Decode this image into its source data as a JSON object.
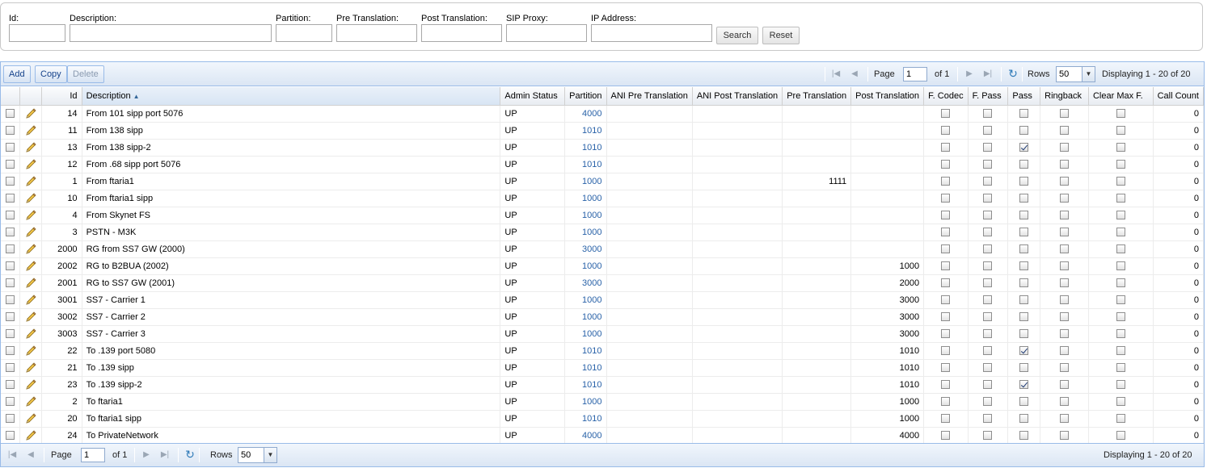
{
  "filters": {
    "id_label": "Id:",
    "description_label": "Description:",
    "partition_label": "Partition:",
    "pre_translation_label": "Pre Translation:",
    "post_translation_label": "Post Translation:",
    "sip_proxy_label": "SIP Proxy:",
    "ip_address_label": "IP Address:",
    "search_label": "Search",
    "reset_label": "Reset"
  },
  "toolbar": {
    "add_label": "Add",
    "copy_label": "Copy",
    "delete_label": "Delete"
  },
  "pager": {
    "page_label": "Page",
    "page_value": "1",
    "of_label": "of 1",
    "rows_label": "Rows",
    "rows_value": "50",
    "display_text": "Displaying 1 - 20 of 20"
  },
  "columns": [
    "Id",
    "Description",
    "Admin Status",
    "Partition",
    "ANI Pre Translation",
    "ANI Post Translation",
    "Pre Translation",
    "Post Translation",
    "F. Codec",
    "F. Pass",
    "Pass",
    "Ringback",
    "Clear Max F.",
    "Call Count"
  ],
  "rows": [
    {
      "id": "14",
      "description": "From 101 sipp port 5076",
      "admin_status": "UP",
      "partition": "4000",
      "ani_pre": "",
      "ani_post": "",
      "pre": "",
      "post": "",
      "f_codec": false,
      "f_pass": false,
      "pass": false,
      "ringback": false,
      "clear_max": false,
      "call_count": "0"
    },
    {
      "id": "11",
      "description": "From 138 sipp",
      "admin_status": "UP",
      "partition": "1010",
      "ani_pre": "",
      "ani_post": "",
      "pre": "",
      "post": "",
      "f_codec": false,
      "f_pass": false,
      "pass": false,
      "ringback": false,
      "clear_max": false,
      "call_count": "0"
    },
    {
      "id": "13",
      "description": "From 138 sipp-2",
      "admin_status": "UP",
      "partition": "1010",
      "ani_pre": "",
      "ani_post": "",
      "pre": "",
      "post": "",
      "f_codec": false,
      "f_pass": false,
      "pass": true,
      "ringback": false,
      "clear_max": false,
      "call_count": "0"
    },
    {
      "id": "12",
      "description": "From .68 sipp port 5076",
      "admin_status": "UP",
      "partition": "1010",
      "ani_pre": "",
      "ani_post": "",
      "pre": "",
      "post": "",
      "f_codec": false,
      "f_pass": false,
      "pass": false,
      "ringback": false,
      "clear_max": false,
      "call_count": "0"
    },
    {
      "id": "1",
      "description": "From ftaria1",
      "admin_status": "UP",
      "partition": "1000",
      "ani_pre": "",
      "ani_post": "",
      "pre": "1111",
      "post": "",
      "f_codec": false,
      "f_pass": false,
      "pass": false,
      "ringback": false,
      "clear_max": false,
      "call_count": "0"
    },
    {
      "id": "10",
      "description": "From ftaria1 sipp",
      "admin_status": "UP",
      "partition": "1000",
      "ani_pre": "",
      "ani_post": "",
      "pre": "",
      "post": "",
      "f_codec": false,
      "f_pass": false,
      "pass": false,
      "ringback": false,
      "clear_max": false,
      "call_count": "0"
    },
    {
      "id": "4",
      "description": "From Skynet FS",
      "admin_status": "UP",
      "partition": "1000",
      "ani_pre": "",
      "ani_post": "",
      "pre": "",
      "post": "",
      "f_codec": false,
      "f_pass": false,
      "pass": false,
      "ringback": false,
      "clear_max": false,
      "call_count": "0"
    },
    {
      "id": "3",
      "description": "PSTN - M3K",
      "admin_status": "UP",
      "partition": "1000",
      "ani_pre": "",
      "ani_post": "",
      "pre": "",
      "post": "",
      "f_codec": false,
      "f_pass": false,
      "pass": false,
      "ringback": false,
      "clear_max": false,
      "call_count": "0"
    },
    {
      "id": "2000",
      "description": "RG from SS7 GW (2000)",
      "admin_status": "UP",
      "partition": "3000",
      "ani_pre": "",
      "ani_post": "",
      "pre": "",
      "post": "",
      "f_codec": false,
      "f_pass": false,
      "pass": false,
      "ringback": false,
      "clear_max": false,
      "call_count": "0"
    },
    {
      "id": "2002",
      "description": "RG to B2BUA (2002)",
      "admin_status": "UP",
      "partition": "1000",
      "ani_pre": "",
      "ani_post": "",
      "pre": "",
      "post": "1000",
      "f_codec": false,
      "f_pass": false,
      "pass": false,
      "ringback": false,
      "clear_max": false,
      "call_count": "0"
    },
    {
      "id": "2001",
      "description": "RG to SS7 GW (2001)",
      "admin_status": "UP",
      "partition": "3000",
      "ani_pre": "",
      "ani_post": "",
      "pre": "",
      "post": "2000",
      "f_codec": false,
      "f_pass": false,
      "pass": false,
      "ringback": false,
      "clear_max": false,
      "call_count": "0"
    },
    {
      "id": "3001",
      "description": "SS7 - Carrier 1",
      "admin_status": "UP",
      "partition": "1000",
      "ani_pre": "",
      "ani_post": "",
      "pre": "",
      "post": "3000",
      "f_codec": false,
      "f_pass": false,
      "pass": false,
      "ringback": false,
      "clear_max": false,
      "call_count": "0"
    },
    {
      "id": "3002",
      "description": "SS7 - Carrier 2",
      "admin_status": "UP",
      "partition": "1000",
      "ani_pre": "",
      "ani_post": "",
      "pre": "",
      "post": "3000",
      "f_codec": false,
      "f_pass": false,
      "pass": false,
      "ringback": false,
      "clear_max": false,
      "call_count": "0"
    },
    {
      "id": "3003",
      "description": "SS7 - Carrier 3",
      "admin_status": "UP",
      "partition": "1000",
      "ani_pre": "",
      "ani_post": "",
      "pre": "",
      "post": "3000",
      "f_codec": false,
      "f_pass": false,
      "pass": false,
      "ringback": false,
      "clear_max": false,
      "call_count": "0"
    },
    {
      "id": "22",
      "description": "To .139 port 5080",
      "admin_status": "UP",
      "partition": "1010",
      "ani_pre": "",
      "ani_post": "",
      "pre": "",
      "post": "1010",
      "f_codec": false,
      "f_pass": false,
      "pass": true,
      "ringback": false,
      "clear_max": false,
      "call_count": "0"
    },
    {
      "id": "21",
      "description": "To .139 sipp",
      "admin_status": "UP",
      "partition": "1010",
      "ani_pre": "",
      "ani_post": "",
      "pre": "",
      "post": "1010",
      "f_codec": false,
      "f_pass": false,
      "pass": false,
      "ringback": false,
      "clear_max": false,
      "call_count": "0"
    },
    {
      "id": "23",
      "description": "To .139 sipp-2",
      "admin_status": "UP",
      "partition": "1010",
      "ani_pre": "",
      "ani_post": "",
      "pre": "",
      "post": "1010",
      "f_codec": false,
      "f_pass": false,
      "pass": true,
      "ringback": false,
      "clear_max": false,
      "call_count": "0"
    },
    {
      "id": "2",
      "description": "To ftaria1",
      "admin_status": "UP",
      "partition": "1000",
      "ani_pre": "",
      "ani_post": "",
      "pre": "",
      "post": "1000",
      "f_codec": false,
      "f_pass": false,
      "pass": false,
      "ringback": false,
      "clear_max": false,
      "call_count": "0"
    },
    {
      "id": "20",
      "description": "To ftaria1 sipp",
      "admin_status": "UP",
      "partition": "1010",
      "ani_pre": "",
      "ani_post": "",
      "pre": "",
      "post": "1000",
      "f_codec": false,
      "f_pass": false,
      "pass": false,
      "ringback": false,
      "clear_max": false,
      "call_count": "0"
    },
    {
      "id": "24",
      "description": "To PrivateNetwork",
      "admin_status": "UP",
      "partition": "4000",
      "ani_pre": "",
      "ani_post": "",
      "pre": "",
      "post": "4000",
      "f_codec": false,
      "f_pass": false,
      "pass": false,
      "ringback": false,
      "clear_max": false,
      "call_count": "0"
    }
  ],
  "icons": {
    "first_page": "first-page-icon",
    "prev_page": "prev-page-icon",
    "next_page": "next-page-icon",
    "last_page": "last-page-icon",
    "refresh": "refresh-icon",
    "edit": "pencil-icon",
    "sort": "sort-ascending-icon"
  },
  "colors": {
    "link": "#2962a8",
    "toolbar_border": "#99bbe8",
    "button_text": "#15428b"
  }
}
